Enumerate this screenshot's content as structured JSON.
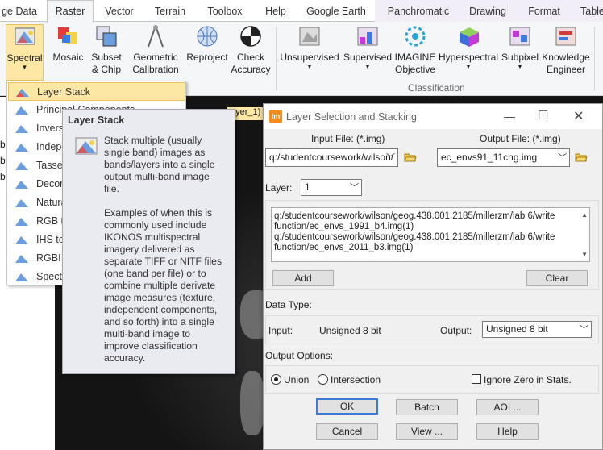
{
  "ribbon": {
    "tabs": [
      {
        "label": "ge Data",
        "active": false
      },
      {
        "label": "Raster",
        "active": true
      },
      {
        "label": "Vector",
        "active": false
      },
      {
        "label": "Terrain",
        "active": false
      },
      {
        "label": "Toolbox",
        "active": false
      },
      {
        "label": "Help",
        "active": false
      },
      {
        "label": "Google Earth",
        "active": false
      },
      {
        "label": "Panchromatic",
        "active": false
      },
      {
        "label": "Drawing",
        "active": false
      },
      {
        "label": "Format",
        "active": false
      },
      {
        "label": "Table",
        "active": false
      }
    ],
    "buttons": [
      {
        "label": "Spectral",
        "icon": "spectral-icon"
      },
      {
        "label": "Mosaic",
        "icon": "mosaic-icon"
      },
      {
        "label": "Subset & Chip",
        "icon": "subset-icon"
      },
      {
        "label": "Geometric Calibration",
        "icon": "geometric-calibration-icon"
      },
      {
        "label": "Reproject",
        "icon": "reproject-icon"
      },
      {
        "label": "Check Accuracy",
        "icon": "check-accuracy-icon"
      },
      {
        "label": "Unsupervised",
        "icon": "unsupervised-icon"
      },
      {
        "label": "Supervised",
        "icon": "supervised-icon"
      },
      {
        "label": "IMAGINE Objective",
        "icon": "imagine-objective-icon"
      },
      {
        "label": "Hyperspectral",
        "icon": "hyperspectral-icon"
      },
      {
        "label": "Subpixel",
        "icon": "subpixel-icon"
      },
      {
        "label": "Knowledge Engineer",
        "icon": "knowledge-engineer-icon"
      }
    ],
    "group_classification": "Classification"
  },
  "menu": {
    "items": [
      "Layer Stack",
      "Principal Components",
      "Inverse Principal Components",
      "Independent Components",
      "Tasseled Cap",
      "Decorrelation Stretch",
      "Natural Color",
      "RGB to IHS",
      "IHS to RGB",
      "RGBI Stretch",
      "Spectral Profile"
    ],
    "side_labels": [
      "b",
      "b",
      "b"
    ]
  },
  "tooltip": {
    "title": "Layer Stack",
    "p1": "Stack multiple (usually single band) images as bands/layers into a single output multi-band image file.",
    "p2": "Examples of when this is commonly used include IKONOS multispectral imagery delivered as separate TIFF or NITF files (one band per file) or to combine multiple derivate image measures (texture, independent components, and so forth) into a single multi-band image to improve classification accuracy."
  },
  "canvas_tab": "ayer_1)",
  "dialog": {
    "title": "Layer Selection and Stacking",
    "app_icon": "Im",
    "input_file_label": "Input File: (*.img)",
    "input_file_value": "q:/studentcoursework/wilson/",
    "output_file_label": "Output File: (*.img)",
    "output_file_value": "ec_envs91_11chg.img",
    "layer_label": "Layer:",
    "layer_value": "1",
    "layer_list": [
      "q:/studentcoursework/wilson/geog.438.001.2185/millerzm/lab 6/write",
      "function/ec_envs_1991_b4.img(1)",
      "q:/studentcoursework/wilson/geog.438.001.2185/millerzm/lab 6/write",
      "function/ec_envs_2011_b3.img(1)"
    ],
    "add_label": "Add",
    "clear_label": "Clear",
    "data_type_label": "Data Type:",
    "input_label": "Input:",
    "input_type": "Unsigned 8 bit",
    "output_label": "Output:",
    "output_type": "Unsigned 8 bit",
    "output_options_label": "Output Options:",
    "union_label": "Union",
    "intersection_label": "Intersection",
    "ignore_zero_label": "Ignore Zero in Stats.",
    "union_selected": true,
    "ignore_zero_checked": false,
    "ok_label": "OK",
    "batch_label": "Batch",
    "aoi_label": "AOI ...",
    "cancel_label": "Cancel",
    "view_label": "View ...",
    "help_label": "Help"
  }
}
